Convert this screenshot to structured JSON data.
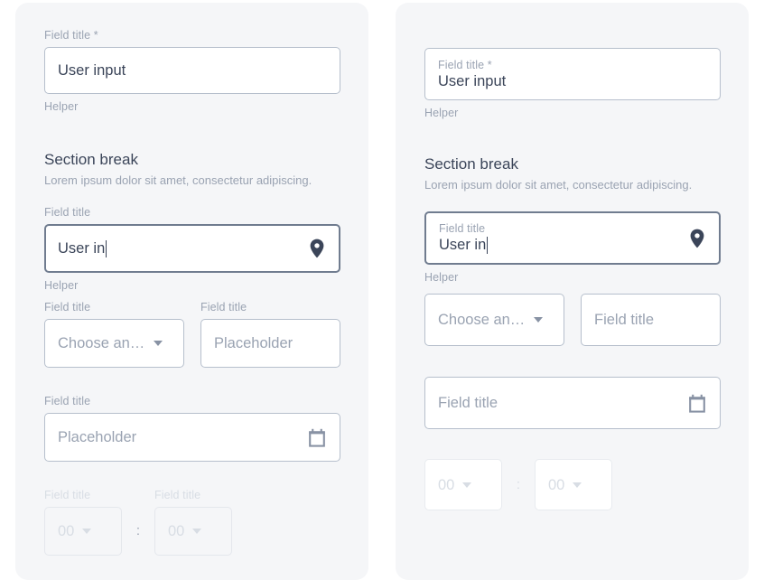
{
  "meta": {
    "background_color": "#ffffff",
    "panel_color": "#f5f6f8",
    "border_color": "#b6bfcc",
    "focus_border_color": "#707c8f",
    "label_color": "#9aa3b2",
    "value_color": "#3b4559",
    "disabled_color": "#d8dde4",
    "accent_icon_color": "#3b4559"
  },
  "left_panel": {
    "text_field": {
      "label": "Field title *",
      "value": "User input",
      "helper": "Helper"
    },
    "section": {
      "title": "Section break",
      "description": "Lorem ipsum dolor sit amet, consectetur adipiscing."
    },
    "location_field": {
      "label": "Field title",
      "value": "User in",
      "helper": "Helper",
      "icon": "location-pin-icon"
    },
    "select_field": {
      "label": "Field title",
      "value": "Choose an…",
      "icon": "chevron-down-icon"
    },
    "plain_field": {
      "label": "Field title",
      "placeholder": "Placeholder"
    },
    "date_field": {
      "label": "Field title",
      "placeholder": "Placeholder",
      "icon": "calendar-icon"
    },
    "time_hours": {
      "label": "Field title",
      "value": "00",
      "icon": "chevron-down-icon"
    },
    "time_separator": ":",
    "time_minutes": {
      "label": "Field title",
      "value": "00",
      "icon": "chevron-down-icon"
    }
  },
  "right_panel": {
    "text_field": {
      "label": "Field title *",
      "value": "User input",
      "helper": "Helper"
    },
    "section": {
      "title": "Section break",
      "description": "Lorem ipsum dolor sit amet, consectetur adipiscing."
    },
    "location_field": {
      "label": "Field title",
      "value": "User in",
      "helper": "Helper",
      "icon": "location-pin-icon"
    },
    "select_field": {
      "value": "Choose an…",
      "icon": "chevron-down-icon"
    },
    "plain_field": {
      "placeholder": "Field title"
    },
    "date_field": {
      "placeholder": "Field title",
      "icon": "calendar-icon"
    },
    "time_hours": {
      "value": "00",
      "icon": "chevron-down-icon"
    },
    "time_separator": ":",
    "time_minutes": {
      "value": "00",
      "icon": "chevron-down-icon"
    }
  }
}
